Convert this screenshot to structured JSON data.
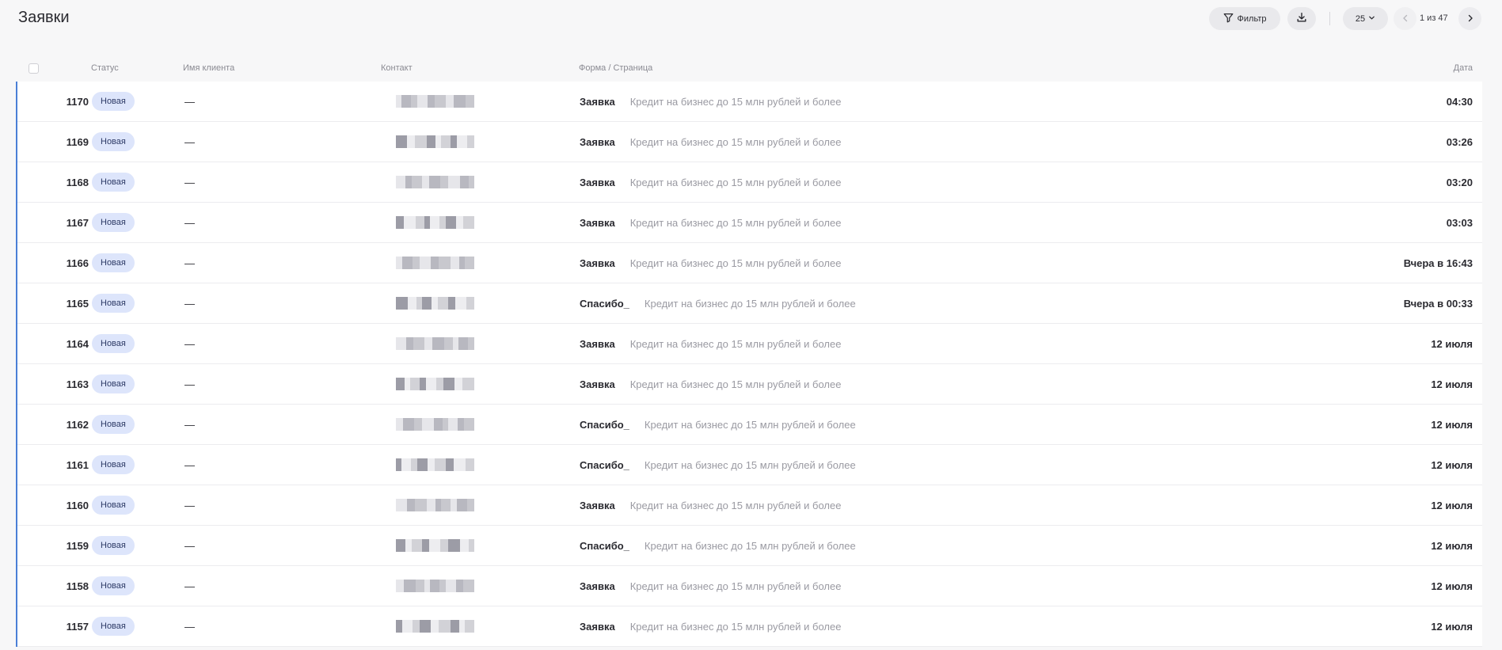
{
  "header": {
    "title": "Заявки",
    "filter_label": "Фильтр",
    "per_page": "25",
    "page_info": "1 из 47"
  },
  "columns": {
    "status": "Статус",
    "client": "Имя клиента",
    "contact": "Контакт",
    "form": "Форма / Страница",
    "date": "Дата"
  },
  "rows": [
    {
      "id": "1170",
      "status": "Новая",
      "client": "—",
      "form": "Заявка",
      "page": "Кредит на бизнес до 15 млн рублей и более",
      "date": "04:30"
    },
    {
      "id": "1169",
      "status": "Новая",
      "client": "—",
      "form": "Заявка",
      "page": "Кредит на бизнес до 15 млн рублей и более",
      "date": "03:26"
    },
    {
      "id": "1168",
      "status": "Новая",
      "client": "—",
      "form": "Заявка",
      "page": "Кредит на бизнес до 15 млн рублей и более",
      "date": "03:20"
    },
    {
      "id": "1167",
      "status": "Новая",
      "client": "—",
      "form": "Заявка",
      "page": "Кредит на бизнес до 15 млн рублей и более",
      "date": "03:03"
    },
    {
      "id": "1166",
      "status": "Новая",
      "client": "—",
      "form": "Заявка",
      "page": "Кредит на бизнес до 15 млн рублей и более",
      "date": "Вчера в 16:43"
    },
    {
      "id": "1165",
      "status": "Новая",
      "client": "—",
      "form": "Спасибо_",
      "page": "Кредит на бизнес до 15 млн рублей и более",
      "date": "Вчера в 00:33"
    },
    {
      "id": "1164",
      "status": "Новая",
      "client": "—",
      "form": "Заявка",
      "page": "Кредит на бизнес до 15 млн рублей и более",
      "date": "12 июля"
    },
    {
      "id": "1163",
      "status": "Новая",
      "client": "—",
      "form": "Заявка",
      "page": "Кредит на бизнес до 15 млн рублей и более",
      "date": "12 июля"
    },
    {
      "id": "1162",
      "status": "Новая",
      "client": "—",
      "form": "Спасибо_",
      "page": "Кредит на бизнес до 15 млн рублей и более",
      "date": "12 июля"
    },
    {
      "id": "1161",
      "status": "Новая",
      "client": "—",
      "form": "Спасибо_",
      "page": "Кредит на бизнес до 15 млн рублей и более",
      "date": "12 июля"
    },
    {
      "id": "1160",
      "status": "Новая",
      "client": "—",
      "form": "Заявка",
      "page": "Кредит на бизнес до 15 млн рублей и более",
      "date": "12 июля"
    },
    {
      "id": "1159",
      "status": "Новая",
      "client": "—",
      "form": "Спасибо_",
      "page": "Кредит на бизнес до 15 млн рублей и более",
      "date": "12 июля"
    },
    {
      "id": "1158",
      "status": "Новая",
      "client": "—",
      "form": "Заявка",
      "page": "Кредит на бизнес до 15 млн рублей и более",
      "date": "12 июля"
    },
    {
      "id": "1157",
      "status": "Новая",
      "client": "—",
      "form": "Заявка",
      "page": "Кредит на бизнес до 15 млн рублей и более",
      "date": "12 июля"
    }
  ],
  "icons": {
    "filter": "filter-icon",
    "download": "download-icon",
    "per_page_dropdown": "chevron-down-icon",
    "prev_page": "chevron-left-icon",
    "next_page": "chevron-right-icon"
  },
  "colors": {
    "accent": "#4a7fd6",
    "badge_bg": "#dde5fb"
  }
}
